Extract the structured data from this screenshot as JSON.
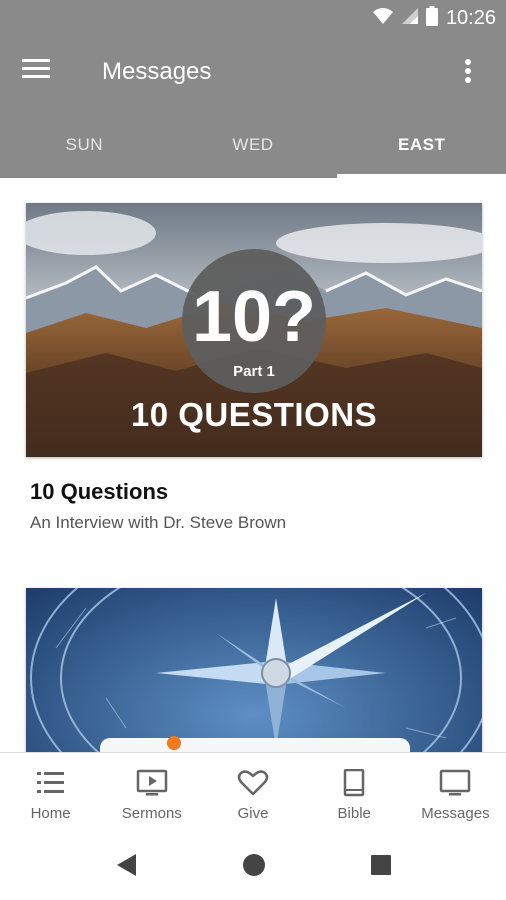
{
  "status_bar": {
    "time": "10:26",
    "icons": [
      "wifi-icon",
      "signal-icon",
      "battery-icon"
    ]
  },
  "app_bar": {
    "title": "Messages",
    "menu_icon": "hamburger-menu-icon",
    "overflow_icon": "more-vert-icon"
  },
  "tabs": [
    {
      "label": "SUN",
      "active": false
    },
    {
      "label": "WED",
      "active": false
    },
    {
      "label": "EAST",
      "active": true
    }
  ],
  "cards": [
    {
      "title": "10 Questions",
      "subtitle": "An Interview with Dr. Steve Brown",
      "image": {
        "badge_big": "10?",
        "badge_small": "Part 1",
        "overlay_text": "10 QUESTIONS"
      }
    },
    {
      "title": "",
      "subtitle": "",
      "image": {}
    }
  ],
  "bottom_nav": [
    {
      "label": "Home",
      "icon": "list-icon"
    },
    {
      "label": "Sermons",
      "icon": "play-screen-icon"
    },
    {
      "label": "Give",
      "icon": "heart-icon"
    },
    {
      "label": "Bible",
      "icon": "book-icon"
    },
    {
      "label": "Messages",
      "icon": "monitor-icon"
    }
  ],
  "colors": {
    "app_bar": "#8a8a8a",
    "accent_dot": "#f07a1f"
  }
}
